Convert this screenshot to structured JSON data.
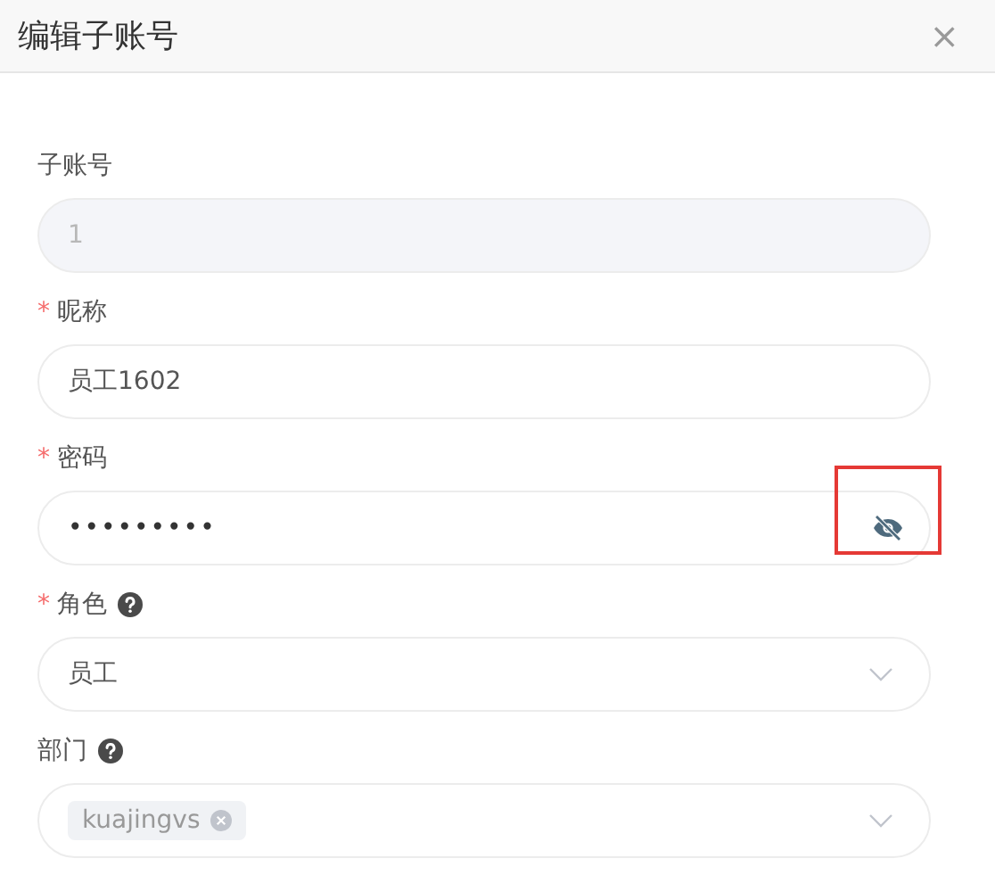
{
  "dialog": {
    "title": "编辑子账号",
    "close": "×"
  },
  "fields": [
    {
      "label": "子账号",
      "kind": "text",
      "help": false,
      "disabled": true,
      "value": "1"
    },
    {
      "required_mark": "*",
      "label": "昵称",
      "kind": "text",
      "help": false,
      "disabled": false,
      "value": "员工1602"
    },
    {
      "required_mark": "*",
      "label": "密码",
      "kind": "password",
      "help": false,
      "disabled": false,
      "value": "•••••••••",
      "highlighted": true
    },
    {
      "required_mark": "*",
      "label": "角色",
      "kind": "select",
      "help": true,
      "disabled": false,
      "value": "员工"
    },
    {
      "label": "部门",
      "kind": "tags",
      "help": true,
      "disabled": false,
      "tags": [
        "kuajingvs"
      ]
    }
  ]
}
